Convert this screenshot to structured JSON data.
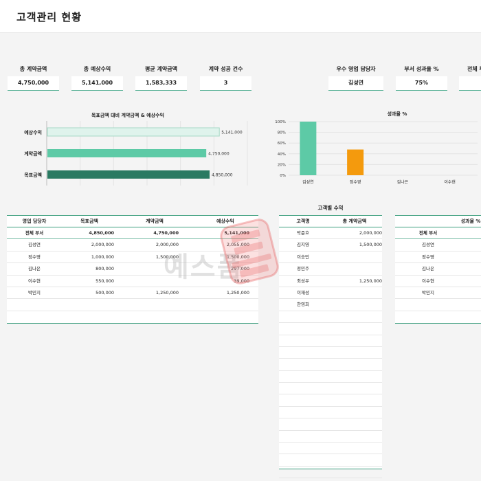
{
  "header": {
    "title": "고객관리 현황"
  },
  "kpis": [
    {
      "label": "총 계약금액",
      "value": "4,750,000"
    },
    {
      "label": "총 예상수익",
      "value": "5,141,000"
    },
    {
      "label": "평균 계약금액",
      "value": "1,583,333"
    },
    {
      "label": "계약 성공 건수",
      "value": "3"
    },
    {
      "label": "우수 영업 담당자",
      "value": "김성연"
    },
    {
      "label": "부서 성과율 %",
      "value": "75%"
    },
    {
      "label": "전체 부",
      "value": ""
    }
  ],
  "colors": {
    "accent": "#3a9d7c",
    "bar_expected": "#dff3ec",
    "bar_contract": "#5dcaa6",
    "bar_target": "#2a7a62",
    "bar_orange": "#f49a0d"
  },
  "chart_data": [
    {
      "type": "bar",
      "orientation": "horizontal",
      "title": "목표금액 대비 계약금액 & 예상수익",
      "categories": [
        "예상수익",
        "계약금액",
        "목표금액"
      ],
      "values": [
        5141000,
        4750000,
        4850000
      ],
      "value_labels": [
        "5,141,000",
        "4,750,000",
        "4,850,000"
      ],
      "xlim": [
        0,
        6000000
      ],
      "grid": true
    },
    {
      "type": "bar",
      "title": "성과율 %",
      "categories": [
        "김성연",
        "정수영",
        "김나은",
        "이수현"
      ],
      "values": [
        100,
        48,
        0,
        0
      ],
      "ylim": [
        0,
        100
      ],
      "yticks": [
        "0%",
        "20%",
        "40%",
        "60%",
        "80%",
        "100%"
      ],
      "grid": true
    }
  ],
  "sales_table": {
    "headers": [
      "영업 담당자",
      "목표금액",
      "계약금액",
      "예상수익"
    ],
    "total": [
      "전체 부서",
      "4,850,000",
      "4,750,000",
      "5,141,000"
    ],
    "rows": [
      [
        "김성연",
        "2,000,000",
        "2,000,000",
        "2,055,000"
      ],
      [
        "정수영",
        "1,000,000",
        "1,500,000",
        "1,500,000"
      ],
      [
        "김나은",
        "800,000",
        "",
        "297,000"
      ],
      [
        "이수현",
        "550,000",
        "",
        "39,000"
      ],
      [
        "박민지",
        "500,000",
        "1,250,000",
        "1,250,000"
      ]
    ]
  },
  "customer_table": {
    "title": "고객별 수익",
    "headers": [
      "고객명",
      "총 계약금액"
    ],
    "rows": [
      [
        "박준호",
        "2,000,000"
      ],
      [
        "김지영",
        "1,500,000"
      ],
      [
        "이승민",
        ""
      ],
      [
        "정민주",
        ""
      ],
      [
        "최성우",
        "1,250,000"
      ],
      [
        "이재성",
        ""
      ],
      [
        "한영희",
        ""
      ]
    ]
  },
  "perf_table": {
    "headers": [
      "",
      "성과율 %"
    ],
    "total": [
      "전체 부서",
      ""
    ],
    "rows": [
      [
        "김성연",
        ""
      ],
      [
        "정수영",
        ""
      ],
      [
        "김나은",
        ""
      ],
      [
        "이수현",
        ""
      ],
      [
        "박민지",
        ""
      ]
    ]
  },
  "watermark": {
    "text": "예스폼"
  }
}
